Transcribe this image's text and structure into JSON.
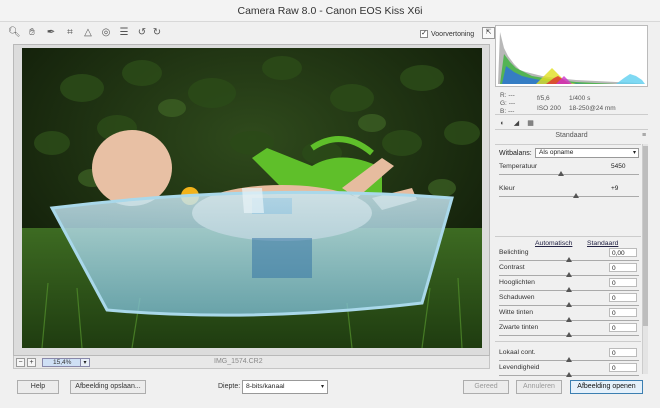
{
  "window": {
    "title": "Camera Raw 8.0  -  Canon EOS Kiss X6i"
  },
  "toolbar": {
    "tools": [
      "zoom-icon",
      "hand-icon",
      "white-balance-icon",
      "crop-icon",
      "straighten-icon",
      "spot-removal-icon",
      "list-icon",
      "rotate-left-icon",
      "rotate-right-icon"
    ],
    "preview_label": "Voorvertoning",
    "preview_checked": true
  },
  "statusbar": {
    "zoom_value": "15,4%",
    "filename": "IMG_1574.CR2"
  },
  "info": {
    "r_label": "R:",
    "r_value": "---",
    "g_label": "G:",
    "g_value": "---",
    "b_label": "B:",
    "b_value": "---",
    "aperture": "f/5,6",
    "shutter": "1/400 s",
    "iso": "ISO 200",
    "lens": "18-250@24 mm"
  },
  "panel": {
    "section_title": "Standaard",
    "white_balance_label": "Witbalans:",
    "white_balance_value": "Als opname",
    "auto_link": "Automatisch",
    "default_link": "Standaard",
    "sliders": [
      {
        "label": "Temperatuur",
        "value": "5450",
        "level": 0.44,
        "boxed": false
      },
      {
        "label": "Kleur",
        "value": "+9",
        "level": 0.55,
        "boxed": false
      },
      {
        "label": "Belichting",
        "value": "0,00",
        "level": 0.5,
        "boxed": true
      },
      {
        "label": "Contrast",
        "value": "0",
        "level": 0.5,
        "boxed": true
      },
      {
        "label": "Hooglichten",
        "value": "0",
        "level": 0.5,
        "boxed": true
      },
      {
        "label": "Schaduwen",
        "value": "0",
        "level": 0.5,
        "boxed": true
      },
      {
        "label": "Witte tinten",
        "value": "0",
        "level": 0.5,
        "boxed": true
      },
      {
        "label": "Zwarte tinten",
        "value": "0",
        "level": 0.5,
        "boxed": true
      },
      {
        "label": "Lokaal cont.",
        "value": "0",
        "level": 0.5,
        "boxed": true
      },
      {
        "label": "Levendigheid",
        "value": "0",
        "level": 0.5,
        "boxed": true
      }
    ]
  },
  "buttons": {
    "help": "Help",
    "save_image": "Afbeelding opslaan...",
    "depth_label": "Diepte:",
    "depth_value": "8-bits/kanaal",
    "done": "Gereed",
    "cancel": "Annuleren",
    "open_image": "Afbeelding openen"
  }
}
